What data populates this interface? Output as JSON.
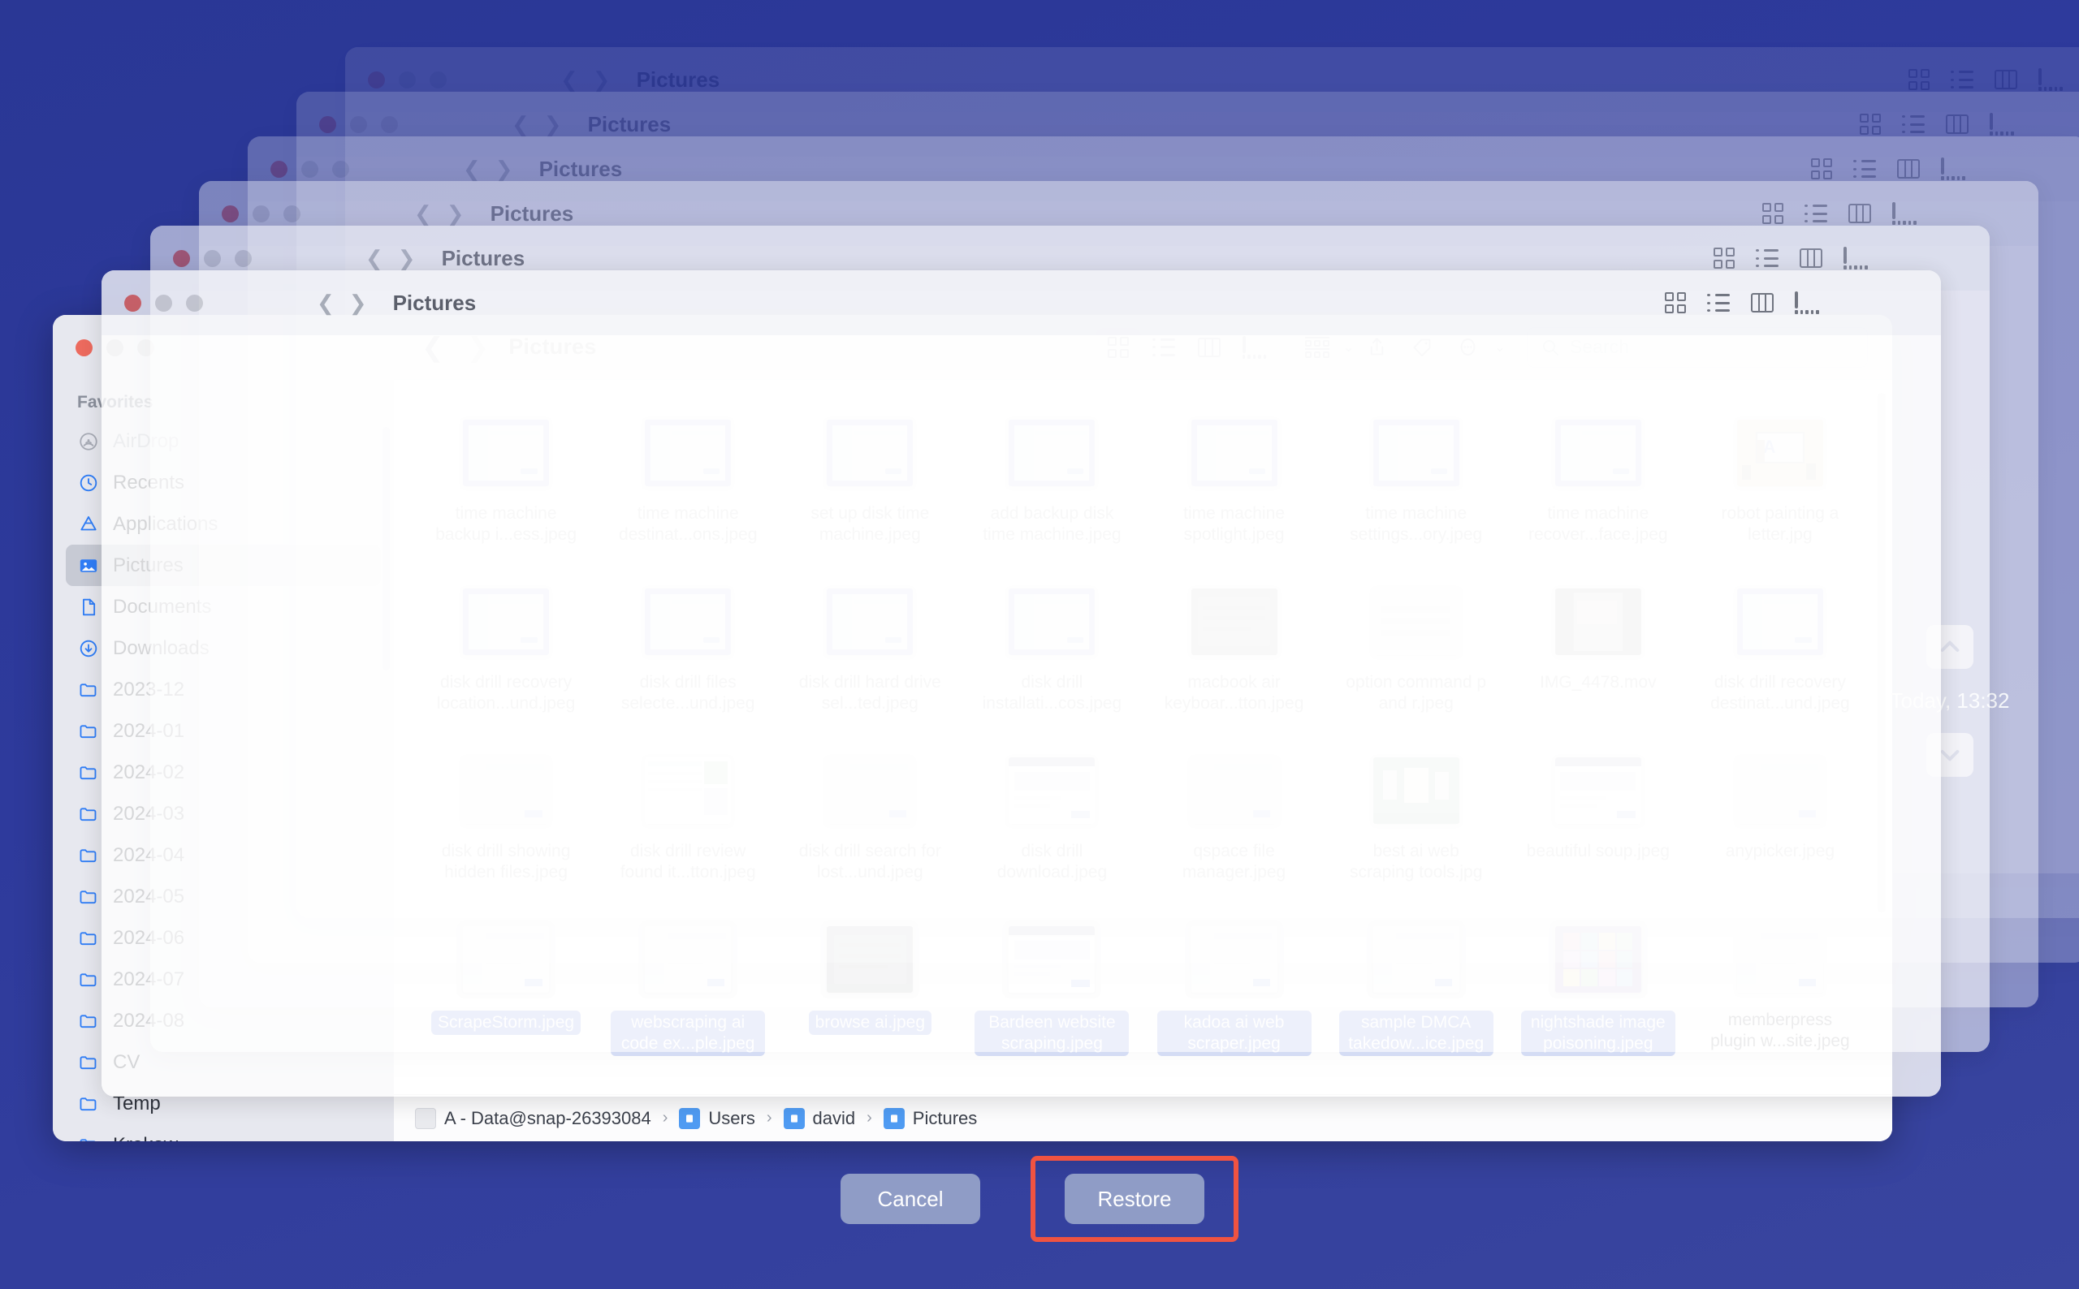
{
  "window": {
    "title": "Pictures",
    "traffic_lights": [
      "close",
      "minimize",
      "maximize"
    ]
  },
  "toolbar": {
    "back_icon": "chevron-left-icon",
    "forward_icon": "chevron-right-icon",
    "view_icon_grid": "grid-view-icon",
    "view_icon_list": "list-view-icon",
    "view_icon_column": "column-view-icon",
    "view_icon_gallery": "gallery-view-icon",
    "group_icon": "group-by-icon",
    "share_icon": "share-icon",
    "tag_icon": "tag-icon",
    "more_icon": "more-actions-icon",
    "search_placeholder": "Search",
    "search_value": ""
  },
  "sidebar": {
    "section_label": "Favorites",
    "items": [
      {
        "label": "AirDrop",
        "icon": "airdrop-icon",
        "state": "disabled"
      },
      {
        "label": "Recents",
        "icon": "clock-icon",
        "state": "normal"
      },
      {
        "label": "Applications",
        "icon": "applications-icon",
        "state": "normal"
      },
      {
        "label": "Pictures",
        "icon": "pictures-icon",
        "state": "selected"
      },
      {
        "label": "Documents",
        "icon": "document-icon",
        "state": "normal"
      },
      {
        "label": "Downloads",
        "icon": "download-icon",
        "state": "normal"
      },
      {
        "label": "2023-12",
        "icon": "folder-icon",
        "state": "normal"
      },
      {
        "label": "2024-01",
        "icon": "folder-icon",
        "state": "normal"
      },
      {
        "label": "2024-02",
        "icon": "folder-icon",
        "state": "normal"
      },
      {
        "label": "2024-03",
        "icon": "folder-icon",
        "state": "normal"
      },
      {
        "label": "2024-04",
        "icon": "folder-icon",
        "state": "normal"
      },
      {
        "label": "2024-05",
        "icon": "folder-icon",
        "state": "normal"
      },
      {
        "label": "2024-06",
        "icon": "folder-icon",
        "state": "normal"
      },
      {
        "label": "2024-07",
        "icon": "folder-icon",
        "state": "normal"
      },
      {
        "label": "2024-08",
        "icon": "folder-icon",
        "state": "normal"
      },
      {
        "label": "CV",
        "icon": "folder-icon",
        "state": "normal"
      },
      {
        "label": "Temp",
        "icon": "folder-icon",
        "state": "normal"
      },
      {
        "label": "Krakow",
        "icon": "folder-icon",
        "state": "normal"
      }
    ]
  },
  "files": [
    {
      "name": "time machine backup i...ess.jpeg",
      "thumb": "screenshot-blue",
      "selected": false
    },
    {
      "name": "time machine destinat...ons.jpeg",
      "thumb": "screenshot-blue",
      "selected": false
    },
    {
      "name": "set up disk time machine.jpeg",
      "thumb": "screenshot-blue",
      "selected": false
    },
    {
      "name": "add backup disk time machine.jpeg",
      "thumb": "screenshot-blue",
      "selected": false
    },
    {
      "name": "time machine spotlight.jpeg",
      "thumb": "screenshot-blue",
      "selected": false
    },
    {
      "name": "time machine settings...ory.jpeg",
      "thumb": "screenshot-blue",
      "selected": false
    },
    {
      "name": "time machine recover...face.jpeg",
      "thumb": "screenshot-blue",
      "selected": false
    },
    {
      "name": "robot painting a letter.jpg",
      "thumb": "illustration-tan",
      "selected": false
    },
    {
      "name": "disk drill recovery location...und.jpeg",
      "thumb": "screenshot-blue",
      "selected": false
    },
    {
      "name": "disk drill files selecte...und.jpeg",
      "thumb": "screenshot-blue",
      "selected": false
    },
    {
      "name": "disk drill hard drive sel...ted.jpeg",
      "thumb": "screenshot-blue",
      "selected": false
    },
    {
      "name": "disk drill installati...cos.jpeg",
      "thumb": "screenshot-blue",
      "selected": false
    },
    {
      "name": "macbook air keyboar...tton.jpeg",
      "thumb": "photo-dark",
      "selected": false
    },
    {
      "name": "option command p and r.jpeg",
      "thumb": "photo-keyboard",
      "selected": false
    },
    {
      "name": "IMG_4478.mov",
      "thumb": "photo-video",
      "selected": false
    },
    {
      "name": "disk drill recovery destinat...und.jpeg",
      "thumb": "screenshot-blue",
      "selected": false
    },
    {
      "name": "disk drill showing hidden files.jpeg",
      "thumb": "screenshot-plain",
      "selected": false
    },
    {
      "name": "disk drill review found it...tton.jpeg",
      "thumb": "screenshot-color",
      "selected": false
    },
    {
      "name": "disk drill search for lost...und.jpeg",
      "thumb": "screenshot-plain",
      "selected": false
    },
    {
      "name": "disk drill download.jpeg",
      "thumb": "screenshot-web",
      "selected": false
    },
    {
      "name": "qspace file manager.jpeg",
      "thumb": "screenshot-plain",
      "selected": false
    },
    {
      "name": "best ai web scraping tools.jpg",
      "thumb": "illustration-green",
      "selected": false
    },
    {
      "name": "beautiful soup.jpeg",
      "thumb": "screenshot-web",
      "selected": false
    },
    {
      "name": "anypicker.jpeg",
      "thumb": "screenshot-plain",
      "selected": false
    },
    {
      "name": "ScrapeStorm.jpeg",
      "thumb": "screenshot-plain",
      "selected": true
    },
    {
      "name": "webscraping ai code ex...ple.jpeg",
      "thumb": "screenshot-plain",
      "selected": true
    },
    {
      "name": "browse ai.jpeg",
      "thumb": "photo-dark",
      "selected": true
    },
    {
      "name": "Bardeen website scraping.jpeg",
      "thumb": "screenshot-web",
      "selected": true
    },
    {
      "name": "kadoa ai web scraper.jpeg",
      "thumb": "screenshot-plain",
      "selected": true
    },
    {
      "name": "sample DMCA takedow...ice.jpeg",
      "thumb": "screenshot-plain",
      "selected": true
    },
    {
      "name": "nightshade image poisoning.jpeg",
      "thumb": "photo-grid",
      "selected": true
    },
    {
      "name": "memberpress plugin w...site.jpeg",
      "thumb": "screenshot-plain",
      "selected": false
    }
  ],
  "pathbar": {
    "segments": [
      {
        "label": "A - Data@snap-26393084",
        "icon": "disk-icon"
      },
      {
        "label": "Users",
        "icon": "users-folder-icon"
      },
      {
        "label": "david",
        "icon": "home-folder-icon"
      },
      {
        "label": "Pictures",
        "icon": "pictures-folder-icon"
      }
    ],
    "separator": "›"
  },
  "timeline": {
    "up_icon": "chevron-up-icon",
    "down_icon": "chevron-down-icon",
    "date_label": "Today, 13:32"
  },
  "footer": {
    "cancel_label": "Cancel",
    "restore_label": "Restore",
    "restore_highlighted": true
  },
  "colors": {
    "background": "#2e3a9c",
    "selection_blue": "#2f56d8",
    "accent_blue": "#2f7df6",
    "highlight_red": "#f05341",
    "button_fill": "#8f9cc6"
  },
  "ghost_windows": [
    {
      "title": "Pictures",
      "opacity": 0.1
    },
    {
      "title": "Pictures",
      "opacity": 0.17
    },
    {
      "title": "Pictures",
      "opacity": 0.26
    },
    {
      "title": "Pictures",
      "opacity": 0.4
    },
    {
      "title": "Pictures",
      "opacity": 0.58
    },
    {
      "title": "Pictures",
      "opacity": 0.8
    },
    {
      "title": "Pictures",
      "opacity": 1.0
    }
  ]
}
